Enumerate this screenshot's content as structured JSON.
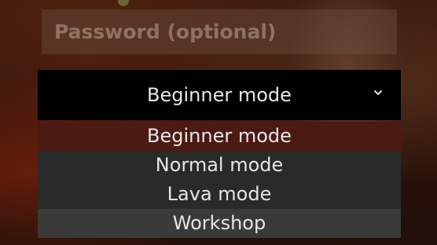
{
  "login_form": {
    "password_placeholder": "Password (optional)",
    "password_value": ""
  },
  "mode_select": {
    "selected_label": "Beginner mode",
    "chevron_icon": "chevron-down-icon",
    "options": [
      {
        "label": "Beginner mode",
        "state": "selected"
      },
      {
        "label": "Normal mode",
        "state": "normal"
      },
      {
        "label": "Lava mode",
        "state": "normal"
      },
      {
        "label": "Workshop",
        "state": "hovered"
      }
    ]
  },
  "colors": {
    "selected_option_bg": "#4c1a12",
    "hovered_option_bg": "#3a3a3a",
    "dropdown_bg": "#2b2a2a",
    "select_bg": "#000000",
    "text": "#e6e6e6"
  }
}
